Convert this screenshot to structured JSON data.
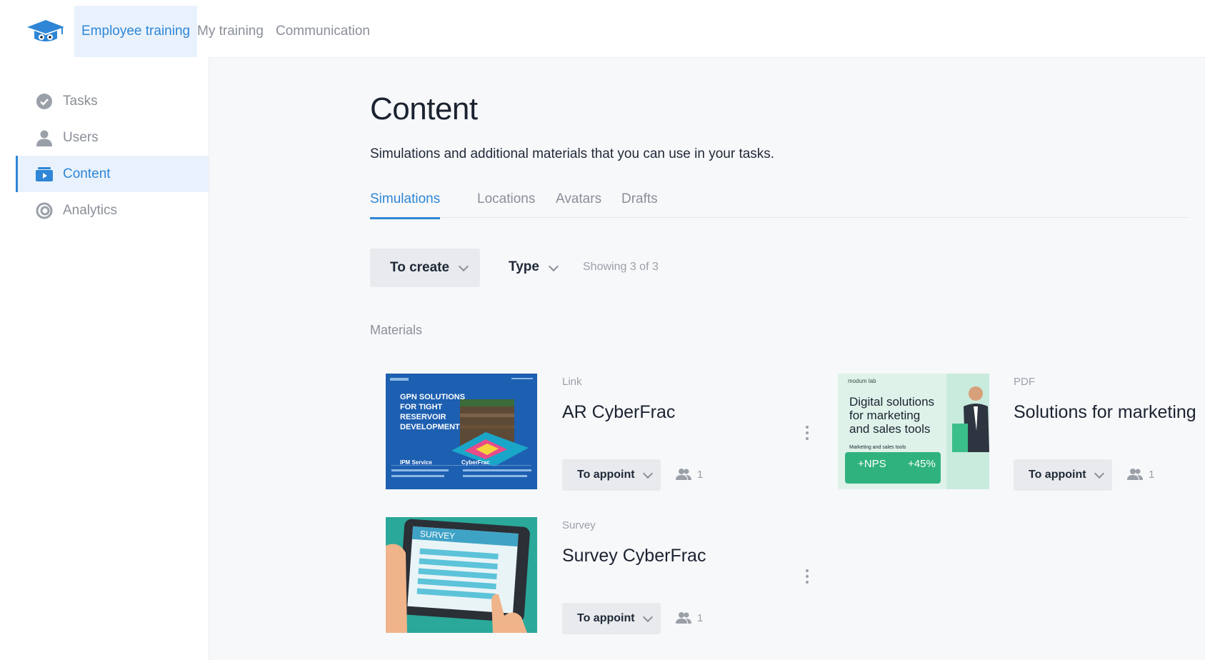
{
  "nav": {
    "tabs": [
      {
        "label": "Employee training",
        "active": true
      },
      {
        "label": "My training",
        "active": false
      },
      {
        "label": "Communication",
        "active": false
      }
    ]
  },
  "sidebar": {
    "items": [
      {
        "label": "Tasks",
        "icon": "check-circle-icon",
        "active": false
      },
      {
        "label": "Users",
        "icon": "user-icon",
        "active": false
      },
      {
        "label": "Content",
        "icon": "video-folder-icon",
        "active": true
      },
      {
        "label": "Analytics",
        "icon": "donut-chart-icon",
        "active": false
      }
    ]
  },
  "main": {
    "title": "Content",
    "description": "Simulations and additional materials that you can use in your tasks.",
    "tabs": [
      {
        "label": "Simulations",
        "active": true
      },
      {
        "label": "Locations",
        "active": false
      },
      {
        "label": "Avatars",
        "active": false
      },
      {
        "label": "Drafts",
        "active": false
      }
    ],
    "create_button": "To create",
    "type_filter": "Type",
    "showing": "Showing 3 of 3",
    "section_label": "Materials"
  },
  "materials": [
    {
      "type": "Link",
      "title": "AR CyberFrac",
      "action": "To appoint",
      "users": "1",
      "thumb": {
        "bg": "#1d5fb0",
        "lines": [
          "GPN SOLUTIONS",
          "FOR TIGHT",
          "RESERVOIR",
          "DEVELOPMENT"
        ],
        "left_caption": "IPM Service",
        "right_caption": "CyberFrac"
      }
    },
    {
      "type": "PDF",
      "title": "Solutions for marketing",
      "action": "To appoint",
      "users": "1",
      "thumb": {
        "bg": "#dff2ea",
        "brand": "modum lab",
        "lines": [
          "Digital solutions",
          "for marketing",
          "and sales tools"
        ],
        "caption": "Marketing and sales tools",
        "stat1": "+NPS",
        "stat2": "+45%"
      }
    },
    {
      "type": "Survey",
      "title": "Survey CyberFrac",
      "action": "To appoint",
      "users": "1",
      "thumb": {
        "bg": "#2aa89a",
        "heading": "SURVEY"
      }
    }
  ],
  "colors": {
    "accent": "#2f86d6",
    "accent_bg": "#e9f2fc",
    "muted": "#8a8f98",
    "button_bg": "#e8eaee"
  }
}
